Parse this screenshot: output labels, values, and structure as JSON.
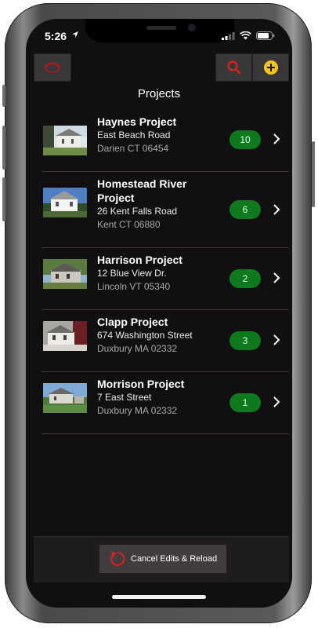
{
  "status_bar": {
    "time": "5:26"
  },
  "nav": {
    "left_icon": "logo-icon",
    "search_icon": "search-icon",
    "add_icon": "add-icon",
    "colors": {
      "search": "#e0201e",
      "add": "#f6c417",
      "logo": "#b3191d"
    }
  },
  "page": {
    "title": "Projects"
  },
  "projects": [
    {
      "name": "Haynes Project",
      "address": "East Beach Road",
      "city": "Darien CT 06454",
      "count": "10"
    },
    {
      "name": "Homestead River Project",
      "address": "26 Kent Falls Road",
      "city": "Kent CT 06880",
      "count": "6"
    },
    {
      "name": "Harrison Project",
      "address": "12 Blue View Dr.",
      "city": "Lincoln VT 05340",
      "count": "2"
    },
    {
      "name": "Clapp Project",
      "address": "674 Washington Street",
      "city": "Duxbury MA 02332",
      "count": "3"
    },
    {
      "name": "Morrison Project",
      "address": "7 East Street",
      "city": "Duxbury MA 02332",
      "count": "1"
    }
  ],
  "footer": {
    "reload_label": "Cancel Edits & Reload",
    "reload_icon": "reload-icon"
  },
  "colors": {
    "badge": "#0f7a1d",
    "background": "#120f12"
  }
}
